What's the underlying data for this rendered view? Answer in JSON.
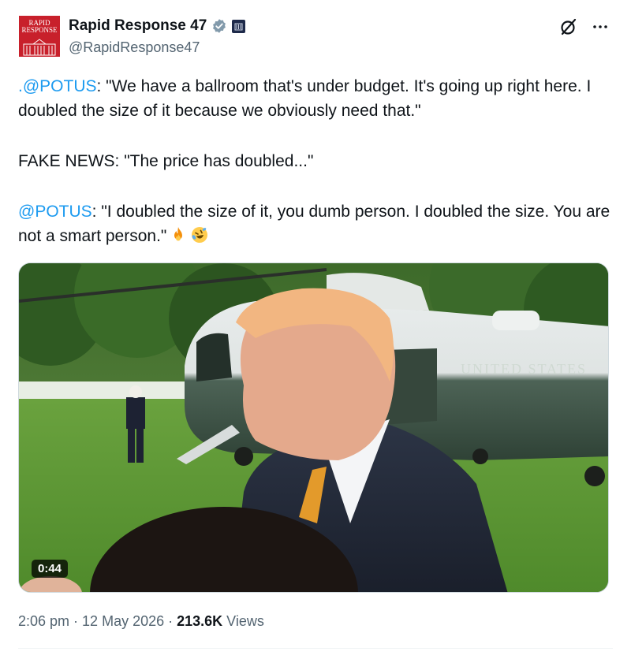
{
  "author": {
    "display_name": "Rapid Response 47",
    "handle": "@RapidResponse47",
    "avatar_text": "RAPID\nRESPONSE"
  },
  "tweet": {
    "p1_mention": ".@POTUS",
    "p1_text": ": \"We have a ballroom that's under budget. It's going up right here. I doubled the size of it because we obviously need that.\"",
    "p2_text": "FAKE NEWS: \"The price has doubled...\"",
    "p3_mention": "@POTUS",
    "p3_text": ": \"I doubled the size of it, you dumb person. I doubled the size. You are not a smart person.\"",
    "emojis": [
      "fire-emoji",
      "rolling-on-floor-laughing-emoji"
    ]
  },
  "media": {
    "duration": "0:44",
    "helicopter_text": "UNITED STATES"
  },
  "meta": {
    "time": "2:06 pm",
    "date": "12 May 2026",
    "views_count": "213.6K",
    "views_label": "Views",
    "separator": "·"
  },
  "colors": {
    "accent": "#1d9bf0",
    "text": "#0f1419",
    "secondary": "#536471",
    "avatar_red": "#c8202b"
  }
}
